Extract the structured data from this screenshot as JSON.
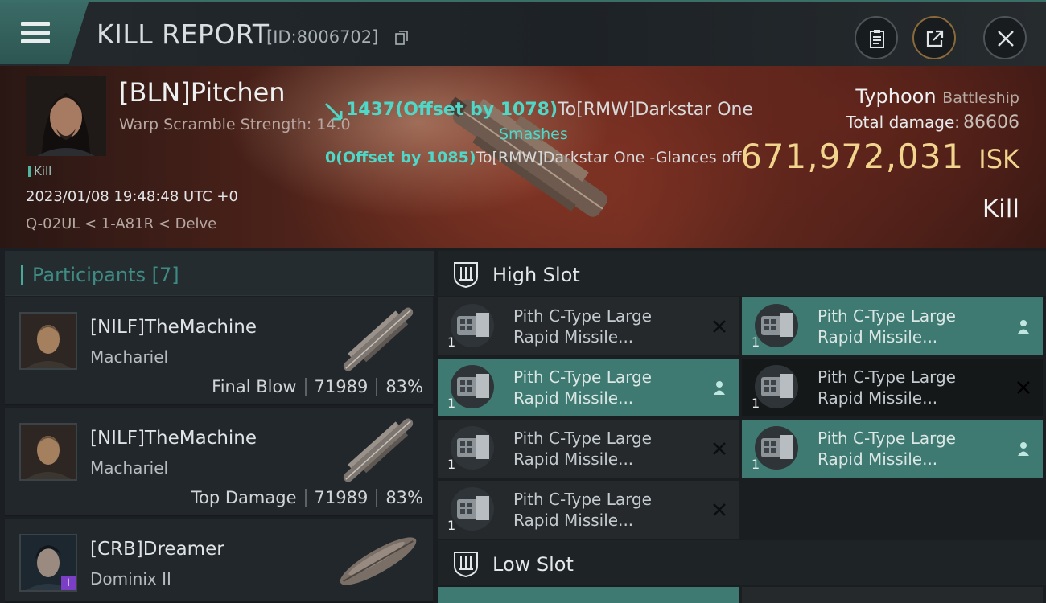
{
  "header": {
    "title": "KILL REPORT",
    "kill_id": "[ID:8006702]",
    "menu_icon": "hamburger-icon",
    "buttons": [
      {
        "name": "clipboard-button",
        "icon": "clipboard-icon"
      },
      {
        "name": "share-button",
        "icon": "share-icon"
      },
      {
        "name": "close-button",
        "icon": "close-icon"
      }
    ]
  },
  "victim": {
    "name": "[BLN]Pitchen",
    "warp_scramble": "Warp Scramble Strength: 14.0",
    "tag": "Kill",
    "time": "2023/01/08 19:48:48 UTC +0",
    "location": "Q-02UL < 1-A81R < Delve"
  },
  "combat_log": {
    "line1_value": "1437(Offset by 1078)",
    "line1_target": "To[RMW]Darkstar One",
    "line2": "Smashes",
    "line3_value": "0(Offset by 1085)",
    "line3_target": "To[RMW]Darkstar One -Glances off"
  },
  "summary": {
    "ship_type": "Typhoon",
    "ship_class": "Battleship",
    "total_damage_label": "Total damage:",
    "total_damage": "86606",
    "isk_value": "671,972,031",
    "isk_unit": "ISK",
    "result": "Kill"
  },
  "participants": {
    "title": "Participants [7]",
    "items": [
      {
        "name": "[NILF]TheMachine",
        "ship": "Machariel",
        "role": "Final Blow",
        "damage": "71989",
        "percent": "83%"
      },
      {
        "name": "[NILF]TheMachine",
        "ship": "Machariel",
        "role": "Top Damage",
        "damage": "71989",
        "percent": "83%"
      },
      {
        "name": "[CRB]Dreamer",
        "ship": "Dominix II",
        "role": "",
        "damage": "",
        "percent": ""
      }
    ]
  },
  "slots": {
    "high": {
      "title": "High Slot",
      "items": [
        {
          "line1": "Pith C-Type Large",
          "line2": "Rapid Missile...",
          "qty": "1",
          "status": "destroyed"
        },
        {
          "line1": "Pith C-Type Large",
          "line2": "Rapid Missile...",
          "qty": "1",
          "status": "dropped"
        },
        {
          "line1": "Pith C-Type Large",
          "line2": "Rapid Missile...",
          "qty": "1",
          "status": "dropped"
        },
        {
          "line1": "Pith C-Type Large",
          "line2": "Rapid Missile...",
          "qty": "1",
          "status": "destroyed"
        },
        {
          "line1": "Pith C-Type Large",
          "line2": "Rapid Missile...",
          "qty": "1",
          "status": "destroyed"
        },
        {
          "line1": "Pith C-Type Large",
          "line2": "Rapid Missile...",
          "qty": "1",
          "status": "dropped"
        },
        {
          "line1": "Pith C-Type Large",
          "line2": "Rapid Missile...",
          "qty": "1",
          "status": "destroyed"
        }
      ]
    },
    "low": {
      "title": "Low Slot"
    }
  },
  "colors": {
    "accent": "#3e7a72",
    "teal_text": "#4fd8c8",
    "isk_gold": "#f1d58d"
  }
}
